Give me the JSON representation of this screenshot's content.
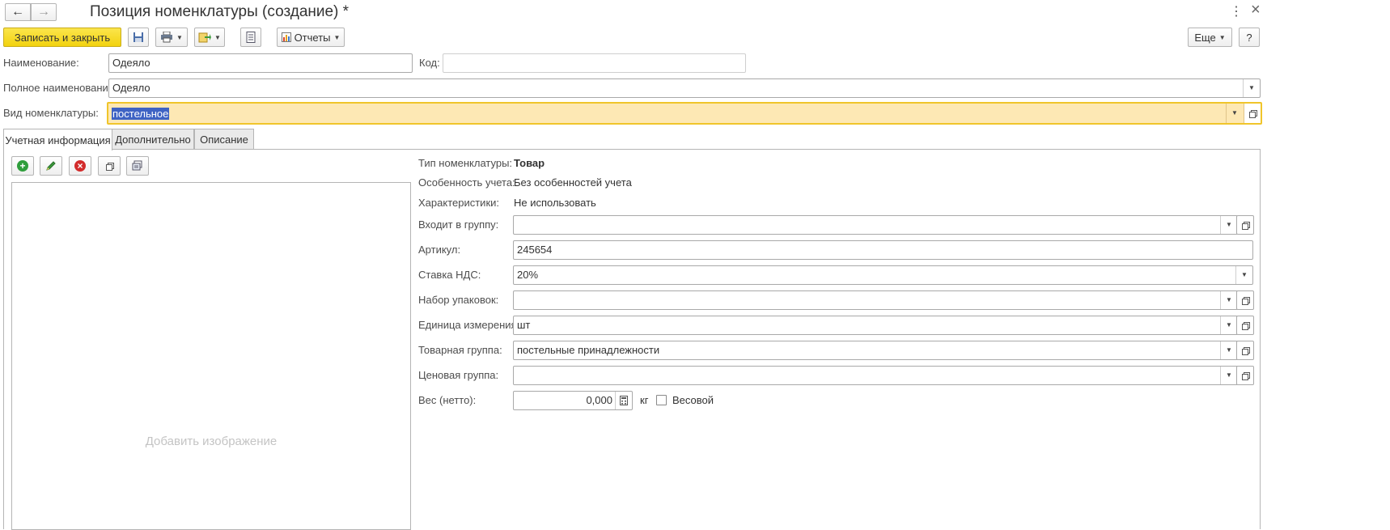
{
  "window": {
    "title": "Позиция номенклатуры (создание) *",
    "more_glyph": "⋮",
    "close_glyph": "×"
  },
  "toolbar": {
    "save_close_label": "Записать и закрыть",
    "reports_label": "Отчеты",
    "more_label": "Еще",
    "help_label": "?"
  },
  "header_fields": {
    "name_label": "Наименование:",
    "name_value": "Одеяло",
    "code_label": "Код:",
    "code_value": "",
    "full_name_label": "Полное наименование:",
    "full_name_value": "Одеяло",
    "kind_label": "Вид номенклатуры:",
    "kind_value": "постельное"
  },
  "tabs": [
    {
      "label": "Учетная информация",
      "active": true
    },
    {
      "label": "Дополнительно",
      "active": false
    },
    {
      "label": "Описание",
      "active": false
    }
  ],
  "image_panel": {
    "placeholder": "Добавить изображение"
  },
  "details": {
    "type_label": "Тип номенклатуры:",
    "type_value": "Товар",
    "feature_label": "Особенность учета:",
    "feature_value": "Без особенностей учета",
    "characteristics_label": "Характеристики:",
    "characteristics_value": "Не использовать",
    "group_label": "Входит в группу:",
    "group_value": "",
    "article_label": "Артикул:",
    "article_value": "245654",
    "vat_label": "Ставка НДС:",
    "vat_value": "20%",
    "packaging_label": "Набор упаковок:",
    "packaging_value": "",
    "unit_label": "Единица измерения:",
    "unit_value": "шт",
    "product_group_label": "Товарная группа:",
    "product_group_value": "постельные принадлежности",
    "price_group_label": "Ценовая группа:",
    "price_group_value": "",
    "weight_label": "Вес (нетто):",
    "weight_value": "0,000",
    "weight_unit": "кг",
    "weighted_label": "Весовой",
    "weighted_checked": false
  },
  "colors": {
    "accent_yellow": "#f2d20f",
    "selection_bg": "#fde8b4",
    "highlight_text_bg": "#3e63c4"
  }
}
